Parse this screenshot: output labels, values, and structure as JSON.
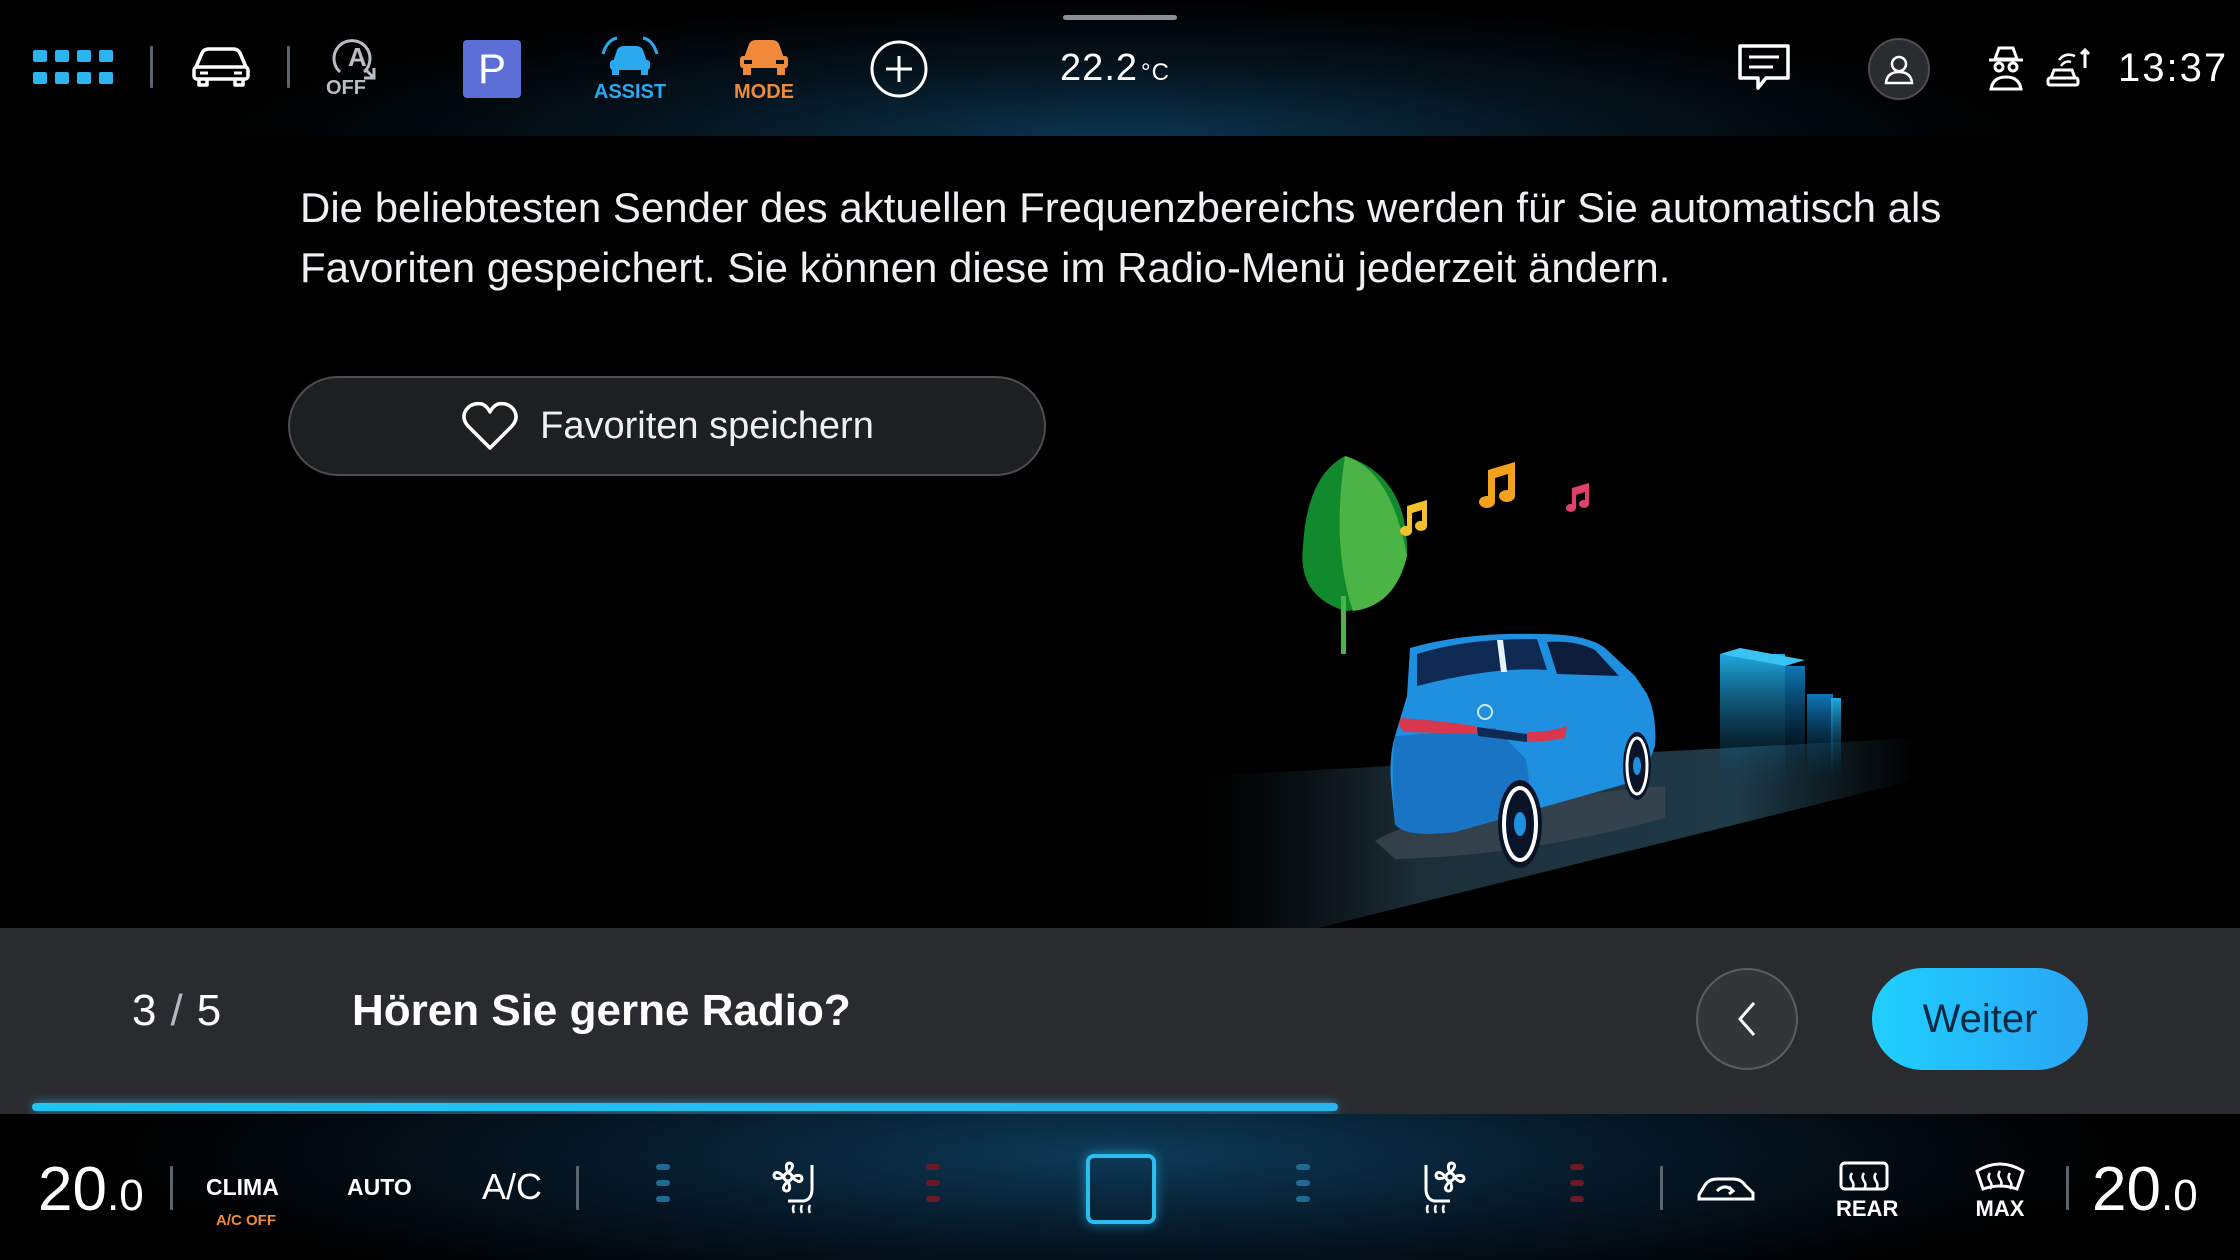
{
  "status_bar": {
    "apps_icon": "grid-icon",
    "car_icon": "car-icon",
    "auto_hold_label": "OFF",
    "parking_label": "P",
    "assist_label": "ASSIST",
    "mode_label": "MODE",
    "add_icon": "plus-circle-icon",
    "outside_temp": "22.2",
    "outside_temp_unit": "°C",
    "time": "13:37"
  },
  "main": {
    "description": "Die beliebtesten Sender des aktuellen Frequenzbereichs werden für Sie automatisch als Favoriten gespeichert. Sie können diese im Radio-Menü jederzeit ändern.",
    "favorites_button": "Favoriten speichern"
  },
  "wizard": {
    "step_current": "3",
    "step_separator": "/",
    "step_total": "5",
    "title": "Hören Sie gerne Radio?",
    "next_button": "Weiter",
    "progress": 0.6
  },
  "climate": {
    "left_temp_int": "20",
    "left_temp_dec": ".0",
    "clima_label": "CLIMA",
    "ac_off_label": "A/C OFF",
    "auto_label": "AUTO",
    "ac_label": "A/C",
    "rear_label": "REAR",
    "max_label": "MAX",
    "right_temp_int": "20",
    "right_temp_dec": ".0"
  },
  "colors": {
    "accent": "#2cbdf0",
    "orange": "#f08a3a",
    "parking_badge": "#5c6fd6"
  }
}
